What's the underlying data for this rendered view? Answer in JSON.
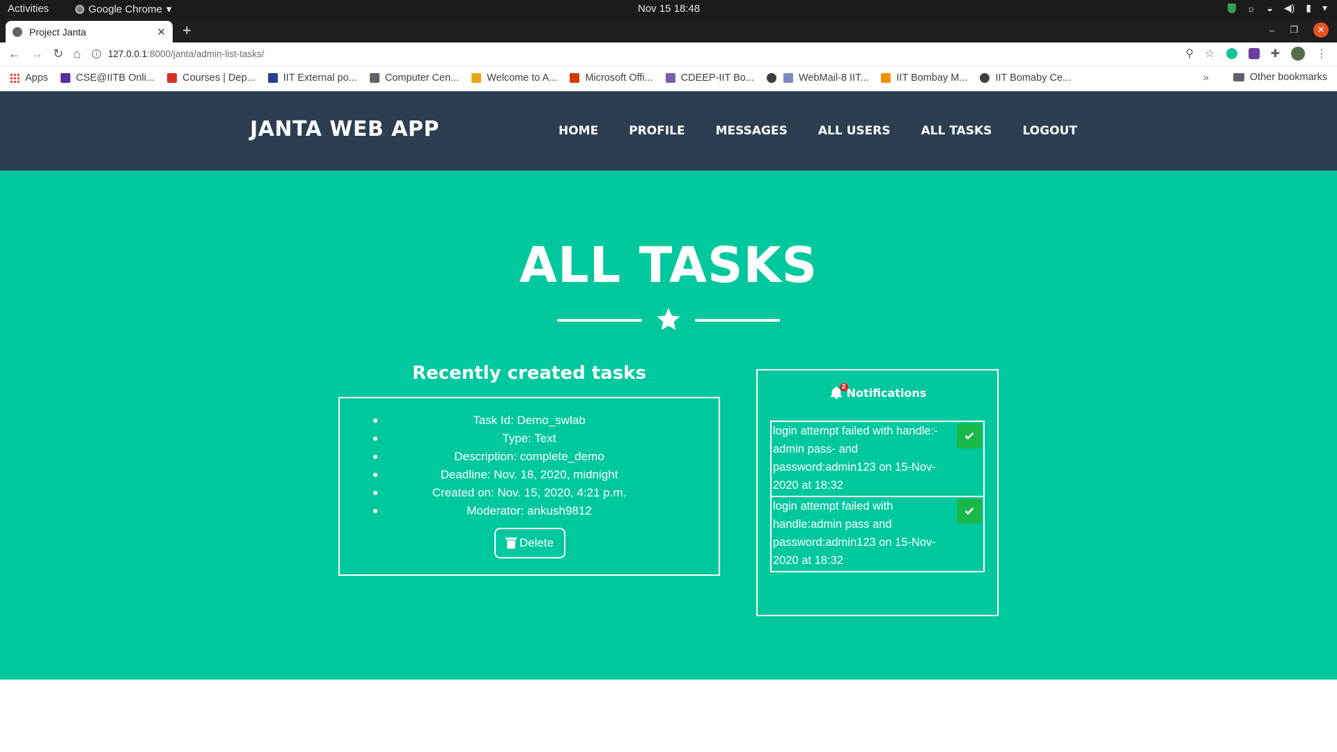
{
  "os": {
    "activities": "Activities",
    "app_name": "Google Chrome",
    "app_menu_arrow": "▾",
    "clock": "Nov 15  18:48"
  },
  "browser": {
    "tab_title": "Project Janta",
    "url_host": "127.0.0.1",
    "url_rest": ":8000/janta/admin-list-tasks/",
    "bookmarks": [
      {
        "label": "Apps",
        "icon": "apps-grid-icon",
        "color": "#ea4335"
      },
      {
        "label": "CSE@IITB Onli...",
        "icon": "cse-icon",
        "color": "#5b2ca0"
      },
      {
        "label": "Courses | Dep...",
        "icon": "courses-icon",
        "color": "#d93025"
      },
      {
        "label": "IIT External po...",
        "icon": "iit-icon",
        "color": "#2c3e90"
      },
      {
        "label": "Computer Cen...",
        "icon": "cc-icon",
        "color": "#5f6368"
      },
      {
        "label": "Welcome to A...",
        "icon": "welcome-icon",
        "color": "#e6a817"
      },
      {
        "label": "Microsoft Offi...",
        "icon": "office-icon",
        "color": "#d83b01"
      },
      {
        "label": "CDEEP-IIT Bo...",
        "icon": "cdeep-icon",
        "color": "#7a5fb0"
      },
      {
        "label": "",
        "icon": "globe-icon",
        "color": "#3c4043"
      },
      {
        "label": "WebMail-8 IIT...",
        "icon": "webmail-icon",
        "color": "#7e8bc4"
      },
      {
        "label": "IIT Bombay M...",
        "icon": "moodle-icon",
        "color": "#f29200"
      },
      {
        "label": "IIT Bomaby Ce...",
        "icon": "globe-icon",
        "color": "#3c4043"
      }
    ],
    "more_bookmarks": "»",
    "other_bookmarks": "Other bookmarks"
  },
  "site": {
    "brand": "JANTA WEB APP",
    "menu": [
      "HOME",
      "PROFILE",
      "MESSAGES",
      "ALL USERS",
      "ALL TASKS",
      "LOGOUT"
    ],
    "page_title": "ALL TASKS",
    "tasks_heading": "Recently created tasks",
    "task": {
      "id": "Task Id: Demo_swlab",
      "type": "Type: Text",
      "description": "Description: complete_demo",
      "deadline": "Deadline: Nov. 18, 2020, midnight",
      "created": "Created on: Nov. 15, 2020, 4:21 p.m.",
      "moderator": "Moderator: ankush9812"
    },
    "delete_label": "Delete",
    "notifications": {
      "title": "Notifications",
      "badge_count": "2",
      "items": [
        "login attempt failed with handle:-admin pass- and password:admin123 on 15-Nov-2020 at 18:32",
        "login attempt failed with handle:admin pass and password:admin123 on 15-Nov-2020 at 18:32"
      ]
    }
  },
  "colors": {
    "navbar": "#2c3e50",
    "masthead": "#00c89e",
    "check_button": "#18b84a",
    "badge": "#e02424"
  }
}
